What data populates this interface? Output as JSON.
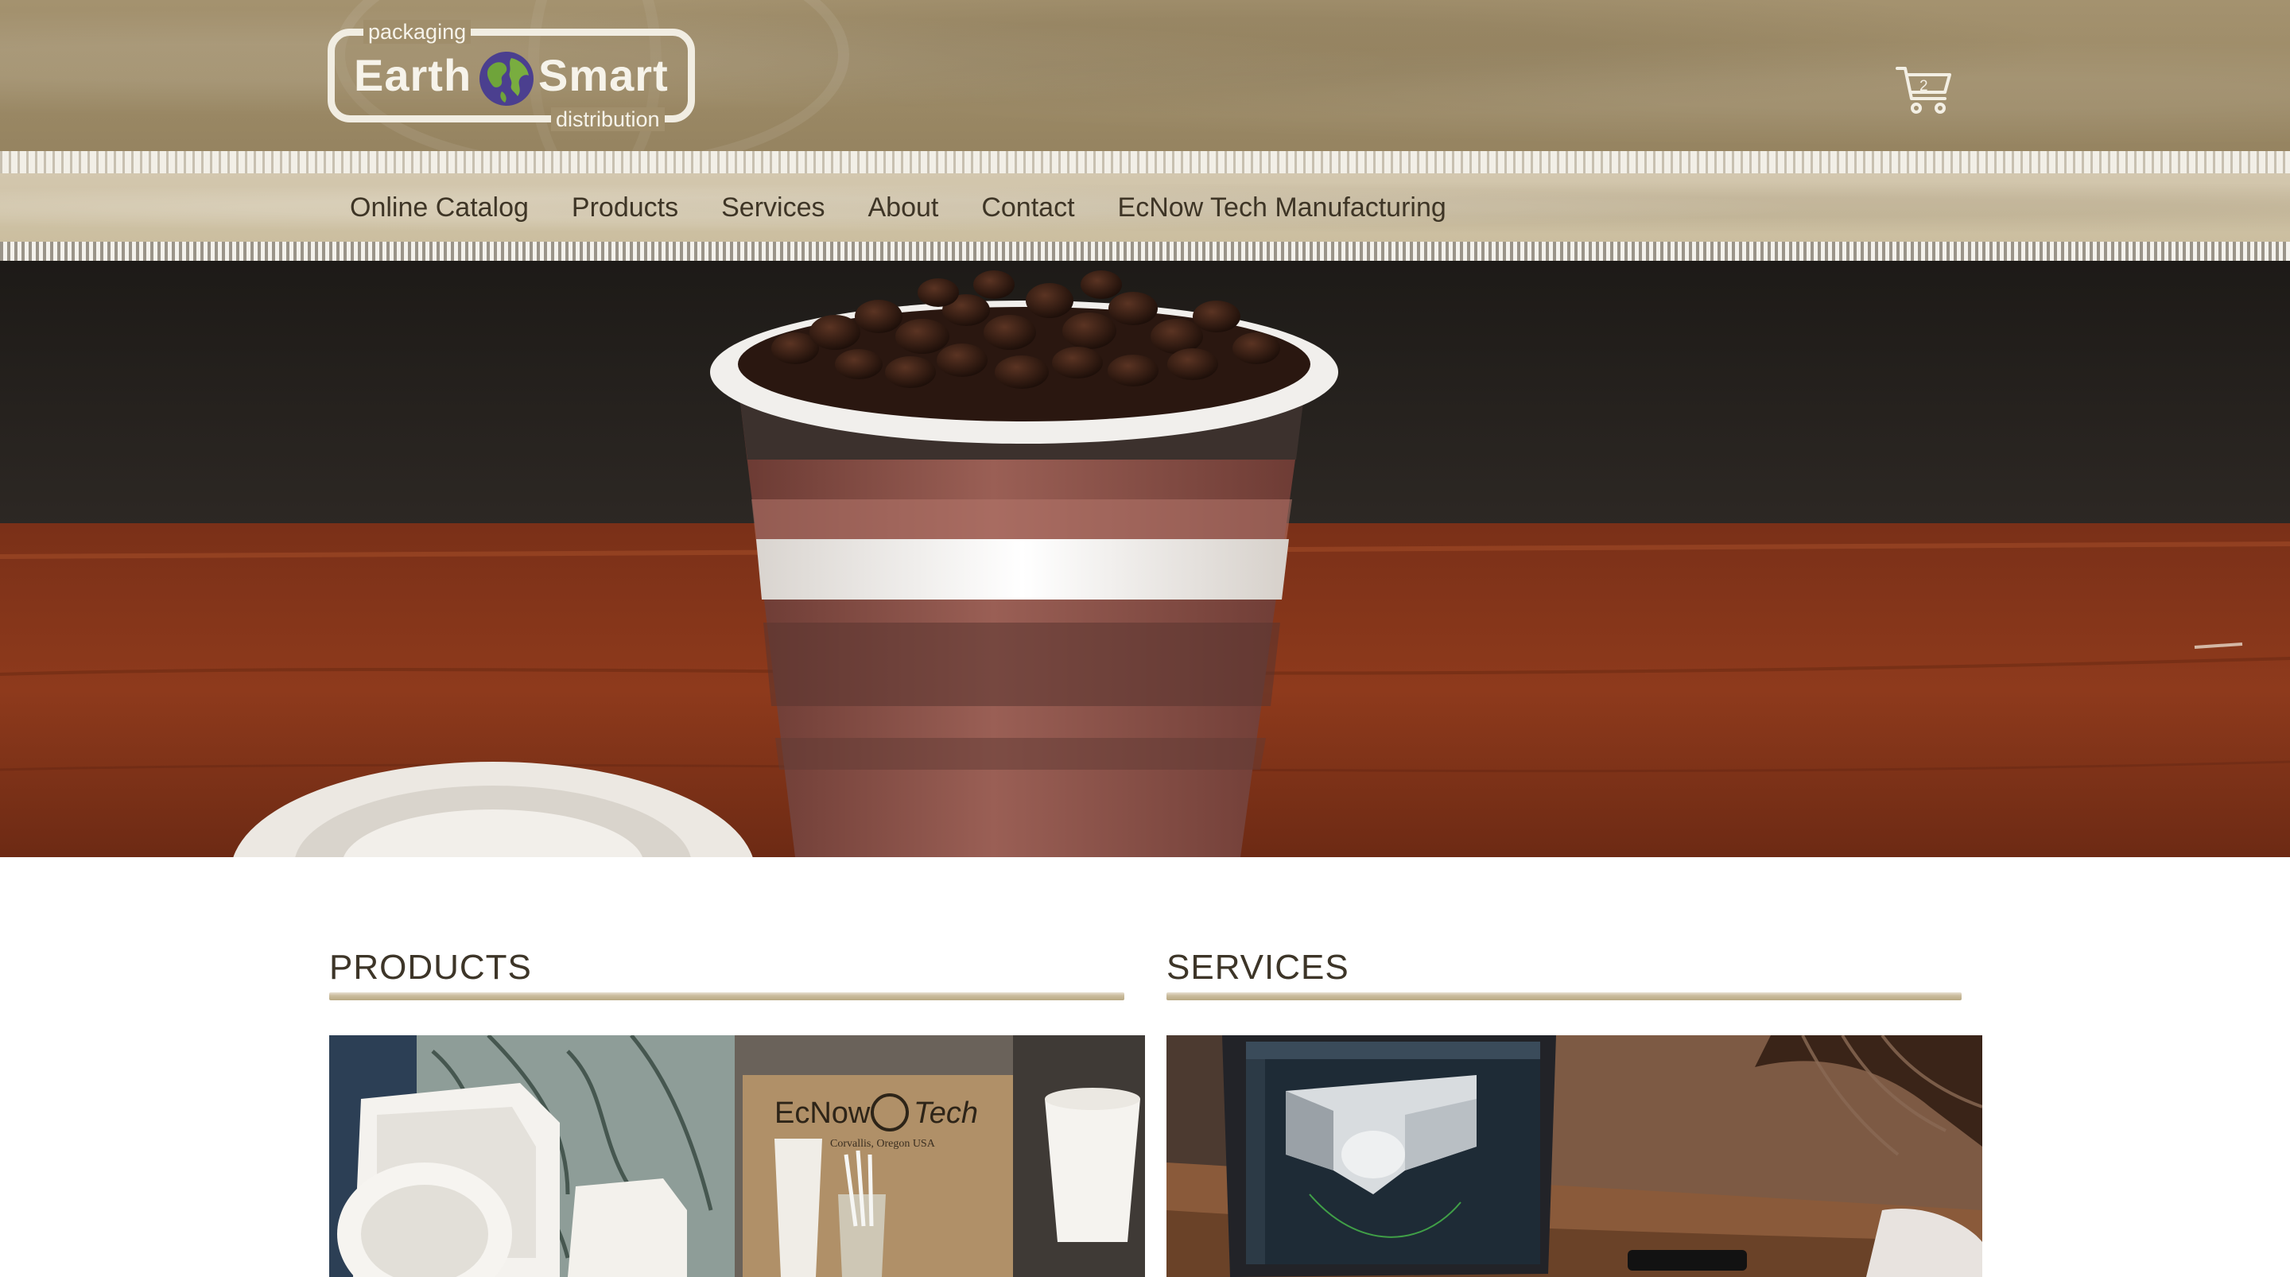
{
  "brand": {
    "tag_top": "packaging",
    "word_left": "Earth",
    "word_right": "Smart",
    "tag_bottom": "distribution",
    "colors": {
      "header": "#9c8a66",
      "nav": "#cbbe9f",
      "text_dark": "#3e3526",
      "logo_frame": "#f1ede2"
    }
  },
  "cart": {
    "icon": "shopping-cart-icon",
    "count": "2"
  },
  "nav": {
    "items": [
      {
        "label": "Online Catalog"
      },
      {
        "label": "Products"
      },
      {
        "label": "Services"
      },
      {
        "label": "About"
      },
      {
        "label": "Contact"
      },
      {
        "label": "EcNow Tech Manufacturing"
      }
    ]
  },
  "hero": {
    "image": "coffee-cup-with-beans-photo"
  },
  "sections": {
    "products": {
      "title": "PRODUCTS",
      "image_text": "EcNow",
      "image_text_2": "Tech",
      "image_subtext": "Corvallis, Oregon USA"
    },
    "services": {
      "title": "SERVICES"
    }
  }
}
